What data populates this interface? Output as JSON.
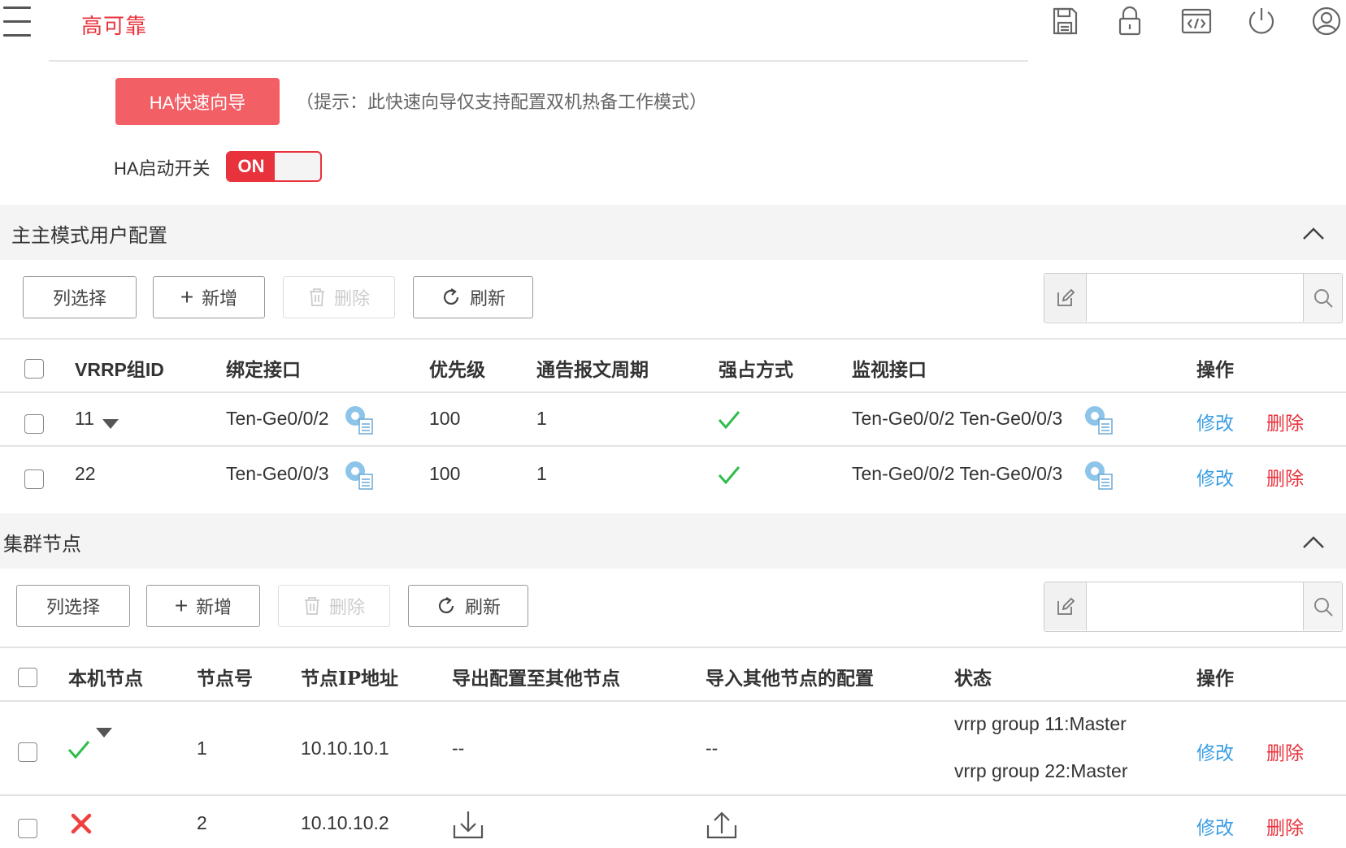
{
  "header": {
    "app_title": "高可靠",
    "icons": [
      "save-icon",
      "lock-icon",
      "code-window-icon",
      "power-icon",
      "user-icon"
    ]
  },
  "ha": {
    "wizard_label": "HA快速向导",
    "hint": "（提示：此快速向导仅支持配置双机热备工作模式）",
    "switch_label": "HA启动开关",
    "switch_state": "ON"
  },
  "section1": {
    "title": "主主模式用户配置",
    "toolbar": {
      "column_select": "列选择",
      "add": "新增",
      "delete": "删除",
      "refresh": "刷新"
    },
    "columns": [
      "VRRP组ID",
      "绑定接口",
      "优先级",
      "通告报文周期",
      "强占方式",
      "监视接口",
      "操作"
    ],
    "rows": [
      {
        "id": "11",
        "iface": "Ten-Ge0/0/2",
        "priority": "100",
        "period": "1",
        "preempt": true,
        "monitor": "Ten-Ge0/0/2 Ten-Ge0/0/3",
        "edit": "修改",
        "del": "删除"
      },
      {
        "id": "22",
        "iface": "Ten-Ge0/0/3",
        "priority": "100",
        "period": "1",
        "preempt": true,
        "monitor": "Ten-Ge0/0/2 Ten-Ge0/0/3",
        "edit": "修改",
        "del": "删除"
      }
    ]
  },
  "section2": {
    "title": "集群节点",
    "toolbar": {
      "column_select": "列选择",
      "add": "新增",
      "delete": "删除",
      "refresh": "刷新"
    },
    "columns": [
      "本机节点",
      "节点号",
      "节点IP地址",
      "导出配置至其他节点",
      "导入其他节点的配置",
      "状态",
      "操作"
    ],
    "rows": [
      {
        "local": true,
        "node": "1",
        "ip": "10.10.10.1",
        "export": "--",
        "import": "--",
        "status": [
          "vrrp group 11:Master",
          "vrrp group 22:Master"
        ],
        "edit": "修改",
        "del": "删除"
      },
      {
        "local": false,
        "node": "2",
        "ip": "10.10.10.2",
        "export_icon": "download-icon",
        "import_icon": "upload-icon",
        "edit": "修改",
        "del": "删除"
      }
    ]
  },
  "colors": {
    "accent": "#e8323c",
    "wizard": "#f25f65",
    "link": "#3a9ee4",
    "ok": "#2ebd4a"
  }
}
